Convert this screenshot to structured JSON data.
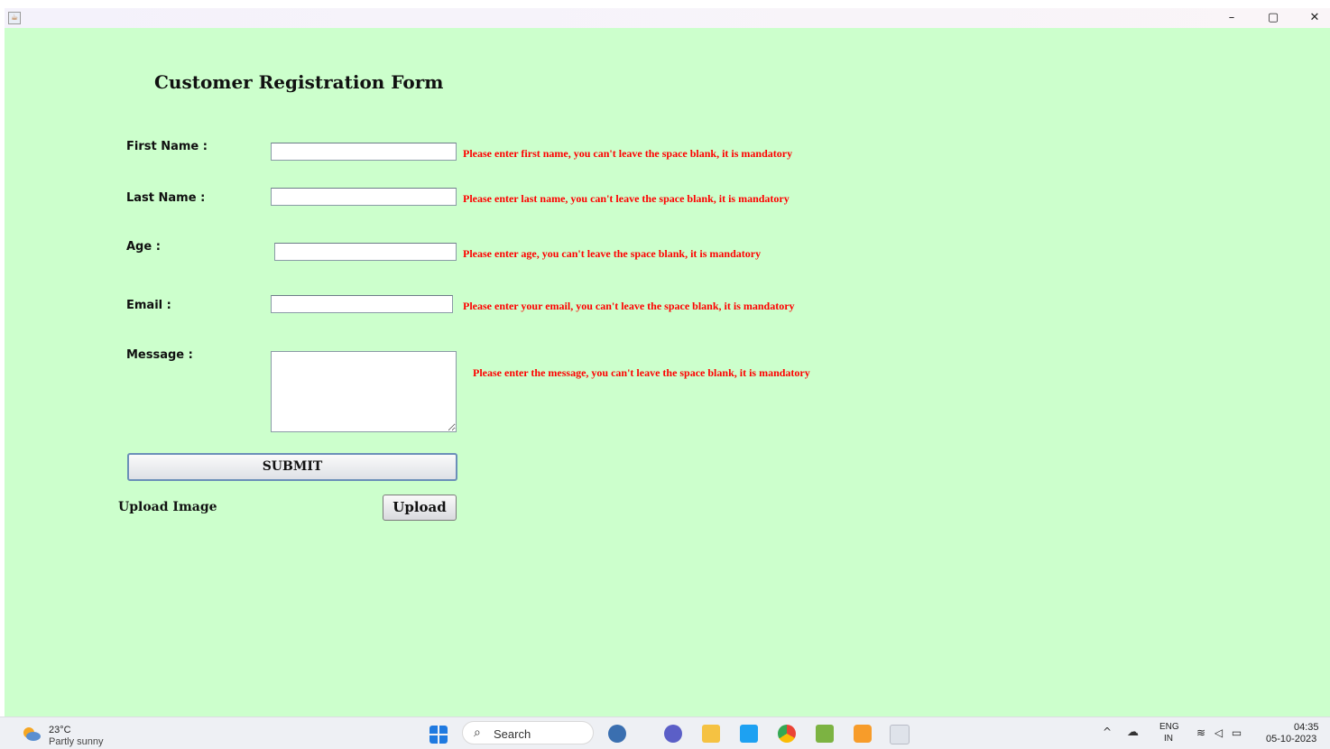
{
  "window": {
    "icon": "java-icon",
    "min_label": "–",
    "max_label": "▢",
    "close_label": "✕"
  },
  "form": {
    "title": "Customer Registration Form",
    "fields": {
      "first_name": {
        "label": "First Name :",
        "value": "",
        "error": "Please enter first name, you can't leave the space blank, it is mandatory"
      },
      "last_name": {
        "label": "Last Name :",
        "value": "",
        "error": "Please enter last name, you can't leave the space blank, it is mandatory"
      },
      "age": {
        "label": "Age :",
        "value": "",
        "error": "Please enter age, you can't leave the space blank, it is mandatory"
      },
      "email": {
        "label": "Email :",
        "value": "",
        "error": "Please enter your email, you can't leave the space blank, it is mandatory"
      },
      "message": {
        "label": "Message :",
        "value": "",
        "error": "Please enter the message, you can't leave the space blank, it is mandatory"
      }
    },
    "submit_label": "SUBMIT",
    "upload_label": "Upload Image",
    "upload_button_label": "Upload",
    "error_color": "#ff0000",
    "background_color": "#ccffcc"
  },
  "taskbar": {
    "weather_temp": "23°C",
    "weather_desc": "Partly sunny",
    "search_label": "Search",
    "apps": [
      "start-icon",
      "search-icon",
      "cricket-game-icon",
      "meet-icon",
      "file-explorer-icon",
      "l-app-icon",
      "chrome-icon",
      "photos-icon",
      "git-icon",
      "java-app-icon"
    ],
    "tray_chevron": "^",
    "lang_top": "ENG",
    "lang_bottom": "IN",
    "clock_time": "04:35",
    "clock_date": "05-10-2023"
  }
}
